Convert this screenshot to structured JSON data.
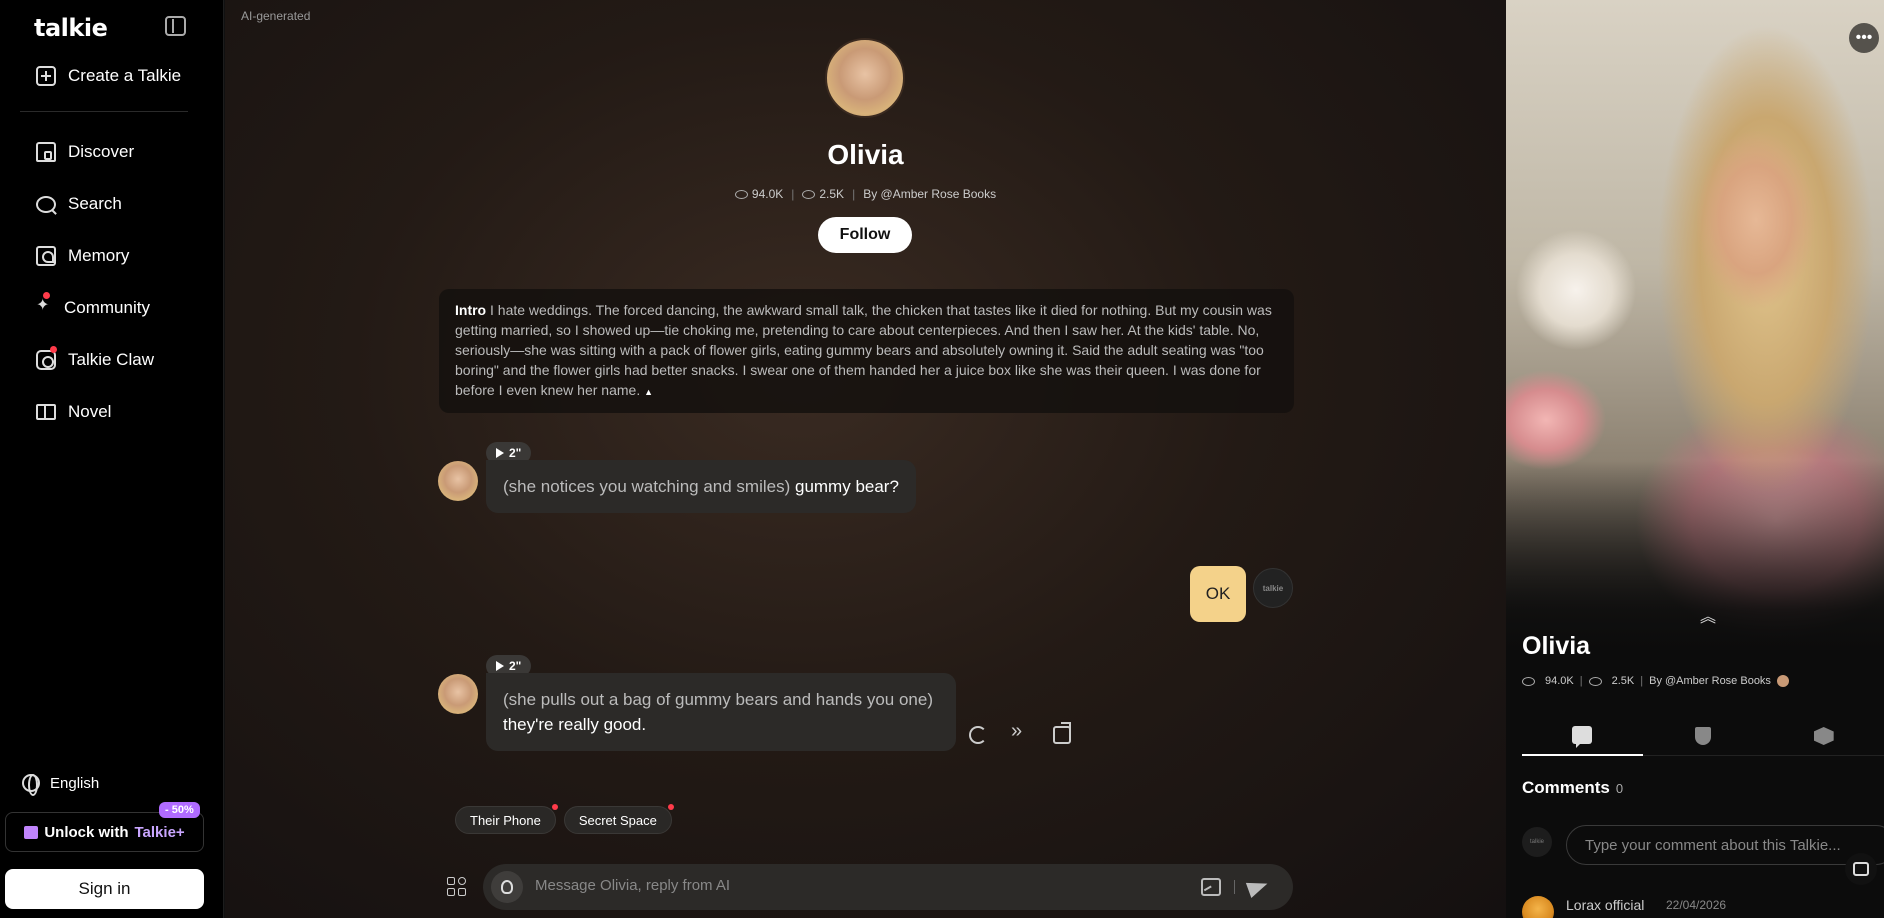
{
  "sidebar": {
    "logo": "talkie",
    "create_label": "Create a Talkie",
    "nav": [
      {
        "label": "Discover",
        "icon": "home-icon"
      },
      {
        "label": "Search",
        "icon": "search-icon"
      },
      {
        "label": "Memory",
        "icon": "memory-icon"
      },
      {
        "label": "Community",
        "icon": "sparkle-icon",
        "badge": true
      },
      {
        "label": "Talkie Claw",
        "icon": "claw-icon",
        "badge": true
      },
      {
        "label": "Novel",
        "icon": "book-icon"
      }
    ],
    "language": "English",
    "unlock_label": "Unlock with",
    "unlock_brand": "Talkie+",
    "discount": "- 50%",
    "signin_label": "Sign in"
  },
  "main": {
    "ai_generated": "AI-generated",
    "name": "Olivia",
    "views": "94.0K",
    "followers": "2.5K",
    "by": "By @Amber Rose Books",
    "follow_label": "Follow",
    "intro_label": "Intro",
    "intro_text": "I hate weddings. The forced dancing, the awkward small talk, the chicken that tastes like it died for nothing. But my cousin was getting married, so I showed up—tie choking me, pretending to care about centerpieces. And then I saw her. At the kids' table. No, seriously—she was sitting with a pack of flower girls, eating gummy bears and absolutely owning it. Said the adult seating was \"too boring\" and the flower girls had better snacks. I swear one of them handed her a juice box like she was their queen. I was done for before I even knew her name.",
    "messages": [
      {
        "duration": "2\"",
        "action": "(she notices you watching and smiles)",
        "text": "gummy bear?"
      },
      {
        "user_text": "OK"
      },
      {
        "duration": "2\"",
        "action": "(she pulls out a bag of gummy bears and hands you one)",
        "text": "they're really good."
      }
    ],
    "chips": [
      "Their Phone",
      "Secret Space"
    ],
    "input_placeholder": "Message Olivia, reply from AI",
    "user_avatar_text": "talkie"
  },
  "right_panel": {
    "name": "Olivia",
    "views": "94.0K",
    "followers": "2.5K",
    "by": "By @Amber Rose Books",
    "comments_label": "Comments",
    "comments_count": "0",
    "comment_placeholder": "Type your comment about this Talkie...",
    "avatar_text": "talkie",
    "first_comment": {
      "user": "Lorax official",
      "date": "22/04/2026"
    }
  },
  "colors": {
    "user_bubble": "#f4d28a",
    "discount": "#b06bff",
    "badge": "#ff3b4a"
  }
}
